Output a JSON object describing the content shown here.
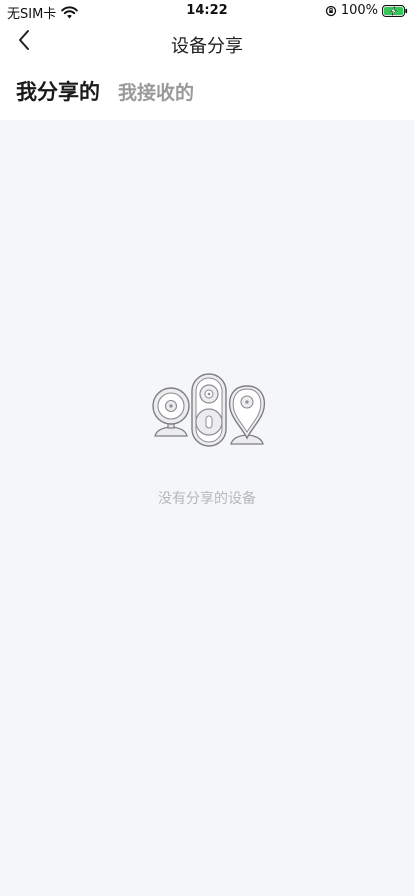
{
  "status_bar": {
    "carrier": "无SIM卡",
    "time": "14:22",
    "battery_percent": "100%",
    "icons": [
      "wifi-icon",
      "orientation-lock-icon",
      "battery-charging-icon"
    ]
  },
  "nav": {
    "title": "设备分享",
    "back_icon": "chevron-left-icon"
  },
  "tabs": [
    {
      "label": "我分享的",
      "active": true
    },
    {
      "label": "我接收的",
      "active": false
    }
  ],
  "empty_state": {
    "illustration": "devices-illustration",
    "message": "没有分享的设备"
  },
  "colors": {
    "content_background": "#f5f6f8",
    "active_tab": "#1a1a1a",
    "inactive_tab": "#9a9a9a",
    "empty_text": "#b5b7bb",
    "battery_green": "#35c759"
  }
}
